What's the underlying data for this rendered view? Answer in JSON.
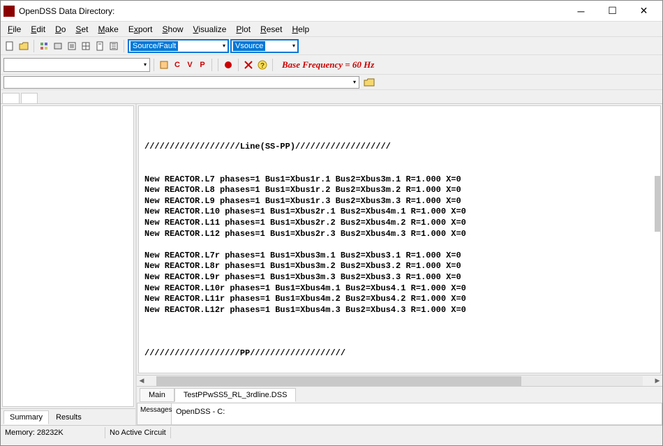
{
  "window": {
    "title": "OpenDSS Data Directory:"
  },
  "menu": {
    "file": "File",
    "edit": "Edit",
    "do": "Do",
    "set": "Set",
    "make": "Make",
    "export": "Export",
    "show": "Show",
    "visualize": "Visualize",
    "plot": "Plot",
    "reset": "Reset",
    "help": "Help"
  },
  "toolbar": {
    "combo1": "Source/Fault",
    "combo2": "Vsource",
    "c": "C",
    "v": "V",
    "p": "P",
    "base_freq": "Base Frequency = 60 Hz"
  },
  "left_tabs": {
    "summary": "Summary",
    "results": "Results"
  },
  "code_tabs": {
    "main": "Main",
    "file": "TestPPwSS5_RL_3rdline.DSS"
  },
  "code_lines": [
    "",
    "",
    "",
    "///////////////////Line(SS-PP)///////////////////",
    "",
    "",
    "New REACTOR.L7 phases=1 Bus1=Xbus1r.1 Bus2=Xbus3m.1 R=1.000 X=0",
    "New REACTOR.L8 phases=1 Bus1=Xbus1r.2 Bus2=Xbus3m.2 R=1.000 X=0",
    "New REACTOR.L9 phases=1 Bus1=Xbus1r.3 Bus2=Xbus3m.3 R=1.000 X=0",
    "New REACTOR.L10 phases=1 Bus1=Xbus2r.1 Bus2=Xbus4m.1 R=1.000 X=0",
    "New REACTOR.L11 phases=1 Bus1=Xbus2r.2 Bus2=Xbus4m.2 R=1.000 X=0",
    "New REACTOR.L12 phases=1 Bus1=Xbus2r.3 Bus2=Xbus4m.3 R=1.000 X=0",
    "",
    "New REACTOR.L7r phases=1 Bus1=Xbus3m.1 Bus2=Xbus3.1 R=1.000 X=0",
    "New REACTOR.L8r phases=1 Bus1=Xbus3m.2 Bus2=Xbus3.2 R=1.000 X=0",
    "New REACTOR.L9r phases=1 Bus1=Xbus3m.3 Bus2=Xbus3.3 R=1.000 X=0",
    "New REACTOR.L10r phases=1 Bus1=Xbus4m.1 Bus2=Xbus4.1 R=1.000 X=0",
    "New REACTOR.L11r phases=1 Bus1=Xbus4m.2 Bus2=Xbus4.2 R=1.000 X=0",
    "New REACTOR.L12r phases=1 Bus1=Xbus4m.3 Bus2=Xbus4.3 R=1.000 X=0",
    "",
    "",
    "",
    "///////////////////PP///////////////////",
    ""
  ],
  "messages": {
    "label": "Messages",
    "content": "OpenDSS - C:"
  },
  "status": {
    "memory": "Memory: 28232K",
    "circuit": "No Active Circuit"
  }
}
